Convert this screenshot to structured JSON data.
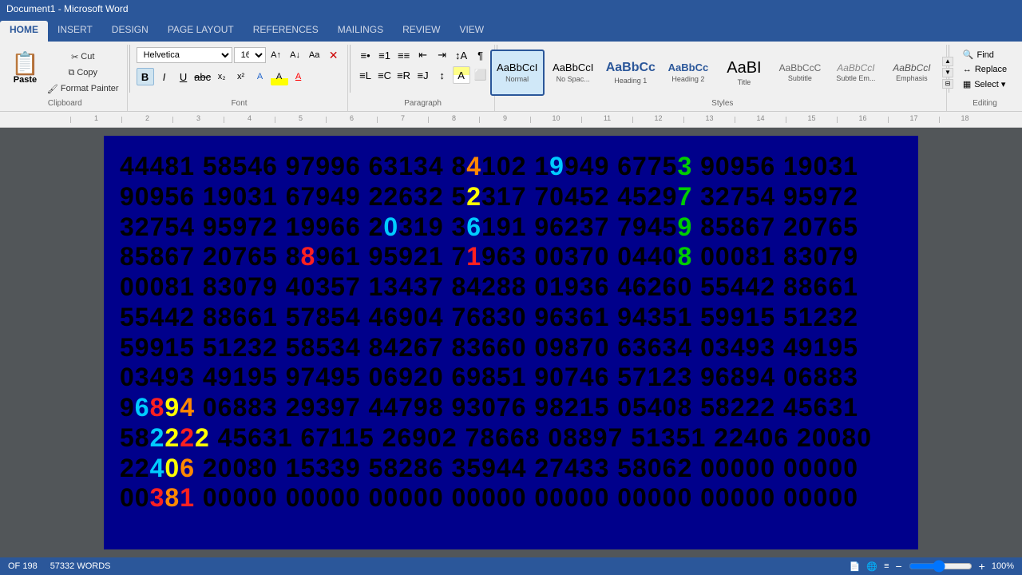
{
  "titlebar": {
    "title": "Document1 - Microsoft Word"
  },
  "tabs": [
    {
      "label": "HOME",
      "active": true
    },
    {
      "label": "INSERT",
      "active": false
    },
    {
      "label": "DESIGN",
      "active": false
    },
    {
      "label": "PAGE LAYOUT",
      "active": false
    },
    {
      "label": "REFERENCES",
      "active": false
    },
    {
      "label": "MAILINGS",
      "active": false
    },
    {
      "label": "REVIEW",
      "active": false
    },
    {
      "label": "VIEW",
      "active": false
    }
  ],
  "clipboard": {
    "paste_label": "Paste",
    "cut_label": "Cut",
    "copy_label": "Copy",
    "format_painter_label": "Format Painter",
    "group_label": "Clipboard"
  },
  "font": {
    "family": "Helvetica",
    "size": "16.5",
    "bold": true,
    "italic": false,
    "underline": false,
    "group_label": "Font"
  },
  "paragraph": {
    "group_label": "Paragraph"
  },
  "styles": {
    "group_label": "Styles",
    "items": [
      {
        "label": "Normal",
        "preview": "AaBbCcI",
        "active": true
      },
      {
        "label": "No Spac...",
        "preview": "AaBbCcI",
        "active": false
      },
      {
        "label": "Heading 1",
        "preview": "AaBbCc",
        "active": false
      },
      {
        "label": "Heading 2",
        "preview": "AaBbCc",
        "active": false
      },
      {
        "label": "Title",
        "preview": "AaBI",
        "active": false
      },
      {
        "label": "Subtitle",
        "preview": "AaBbCcC",
        "active": false
      },
      {
        "label": "Subtle Em...",
        "preview": "AaBbCcI",
        "active": false
      },
      {
        "label": "Emphasis",
        "preview": "AaBbCcI",
        "active": false
      }
    ]
  },
  "editing": {
    "group_label": "Editing",
    "find_label": "Find",
    "replace_label": "Replace",
    "select_label": "Select ▾"
  },
  "document": {
    "lines": [
      {
        "segments": [
          {
            "text": "44481 58546 97996 63134 8",
            "color": "black"
          },
          {
            "text": "4",
            "color": "orange"
          },
          {
            "text": "102 1",
            "color": "black"
          },
          {
            "text": "9",
            "color": "cyan"
          },
          {
            "text": "949 6775",
            "color": "black"
          },
          {
            "text": "3",
            "color": "green"
          },
          {
            "text": " 90956 19031",
            "color": "black"
          }
        ]
      },
      {
        "segments": [
          {
            "text": "90956 19031 67949 22632 5",
            "color": "black"
          },
          {
            "text": "2",
            "color": "yellow"
          },
          {
            "text": "317 70452 4529",
            "color": "black"
          },
          {
            "text": "7",
            "color": "green"
          },
          {
            "text": " 32754 95972",
            "color": "black"
          }
        ]
      },
      {
        "segments": [
          {
            "text": "32754 95972 19966 2",
            "color": "black"
          },
          {
            "text": "0",
            "color": "cyan"
          },
          {
            "text": "319 3",
            "color": "black"
          },
          {
            "text": "6",
            "color": "cyan"
          },
          {
            "text": "191 96237 7945",
            "color": "black"
          },
          {
            "text": "9",
            "color": "green"
          },
          {
            "text": " 85867 20765",
            "color": "black"
          }
        ]
      },
      {
        "segments": [
          {
            "text": "85867 20765 8",
            "color": "black"
          },
          {
            "text": "8",
            "color": "red"
          },
          {
            "text": "961 95921 7",
            "color": "black"
          },
          {
            "text": "1",
            "color": "red"
          },
          {
            "text": "963 00370 0440",
            "color": "black"
          },
          {
            "text": "8",
            "color": "green"
          },
          {
            "text": " 00081 83079",
            "color": "black"
          }
        ]
      },
      {
        "segments": [
          {
            "text": "00081 83079 40357 13437 84288 01936 46260 55442 88661",
            "color": "black"
          }
        ]
      },
      {
        "segments": [
          {
            "text": "55442 88661 57854 46904 76830 96361 94351 59915 51232",
            "color": "black"
          }
        ]
      },
      {
        "segments": [
          {
            "text": "59915 51232 58534 84267 83660 09870 63634 03493 49195",
            "color": "black"
          }
        ]
      },
      {
        "segments": [
          {
            "text": "03493 49195 97495 06920 69851 90746 57123 96894 06883",
            "color": "black"
          }
        ]
      },
      {
        "segments": [
          {
            "text": "9",
            "color": "black"
          },
          {
            "text": "6",
            "color": "cyan"
          },
          {
            "text": "8",
            "color": "red"
          },
          {
            "text": "9",
            "color": "yellow"
          },
          {
            "text": "4",
            "color": "orange"
          },
          {
            "text": " 06883 29397 44798 93076 98215 05408 58222 45631",
            "color": "black"
          }
        ]
      },
      {
        "segments": [
          {
            "text": "58",
            "color": "black"
          },
          {
            "text": "2",
            "color": "cyan"
          },
          {
            "text": "2",
            "color": "yellow"
          },
          {
            "text": "2",
            "color": "red"
          },
          {
            "text": "2",
            "color": "yellow"
          },
          {
            "text": " 45631 67115 26902 78668 08897 51351 22406 20080",
            "color": "black"
          }
        ]
      },
      {
        "segments": [
          {
            "text": "22",
            "color": "black"
          },
          {
            "text": "4",
            "color": "cyan"
          },
          {
            "text": "0",
            "color": "yellow"
          },
          {
            "text": "6",
            "color": "orange"
          },
          {
            "text": " 20080 15339 58286 35944 27433 58062 00000 00000",
            "color": "black"
          }
        ]
      },
      {
        "segments": [
          {
            "text": "00",
            "color": "black"
          },
          {
            "text": "3",
            "color": "red"
          },
          {
            "text": "8",
            "color": "orange"
          },
          {
            "text": "1",
            "color": "red"
          },
          {
            "text": " 00000 00000 00000 00000 00000 00000 00000 00000",
            "color": "black"
          }
        ]
      }
    ]
  },
  "statusbar": {
    "page_info": "OF 198",
    "words_label": "57332 WORDS",
    "zoom_percent": "100%"
  },
  "ruler": {
    "marks": [
      "1",
      "2",
      "3",
      "4",
      "5",
      "6",
      "7",
      "8",
      "9",
      "10",
      "11",
      "12",
      "13",
      "14",
      "15",
      "16",
      "17",
      "18"
    ]
  }
}
